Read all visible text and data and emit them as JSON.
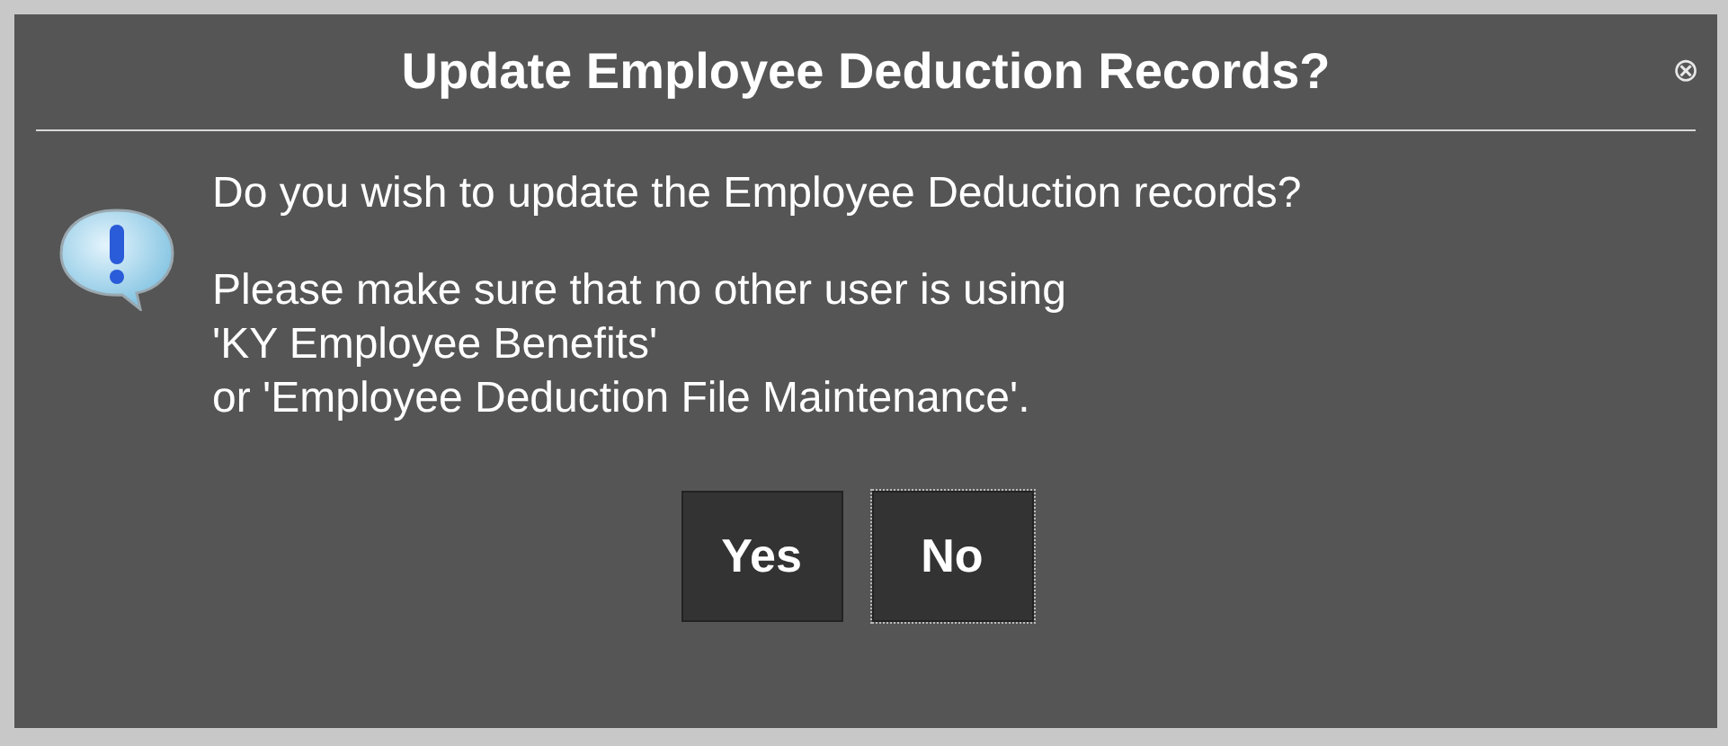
{
  "dialog": {
    "title": "Update Employee Deduction Records?",
    "close": "⊗",
    "message": [
      "Do you wish to update the Employee Deduction records?"
    ],
    "note_lines": [
      "Please make sure that no other user is using",
      "'KY Employee Benefits'",
      "or 'Employee Deduction File Maintenance'."
    ],
    "buttons": [
      {
        "label": "Yes",
        "focused": false
      },
      {
        "label": "No",
        "focused": true
      }
    ]
  }
}
